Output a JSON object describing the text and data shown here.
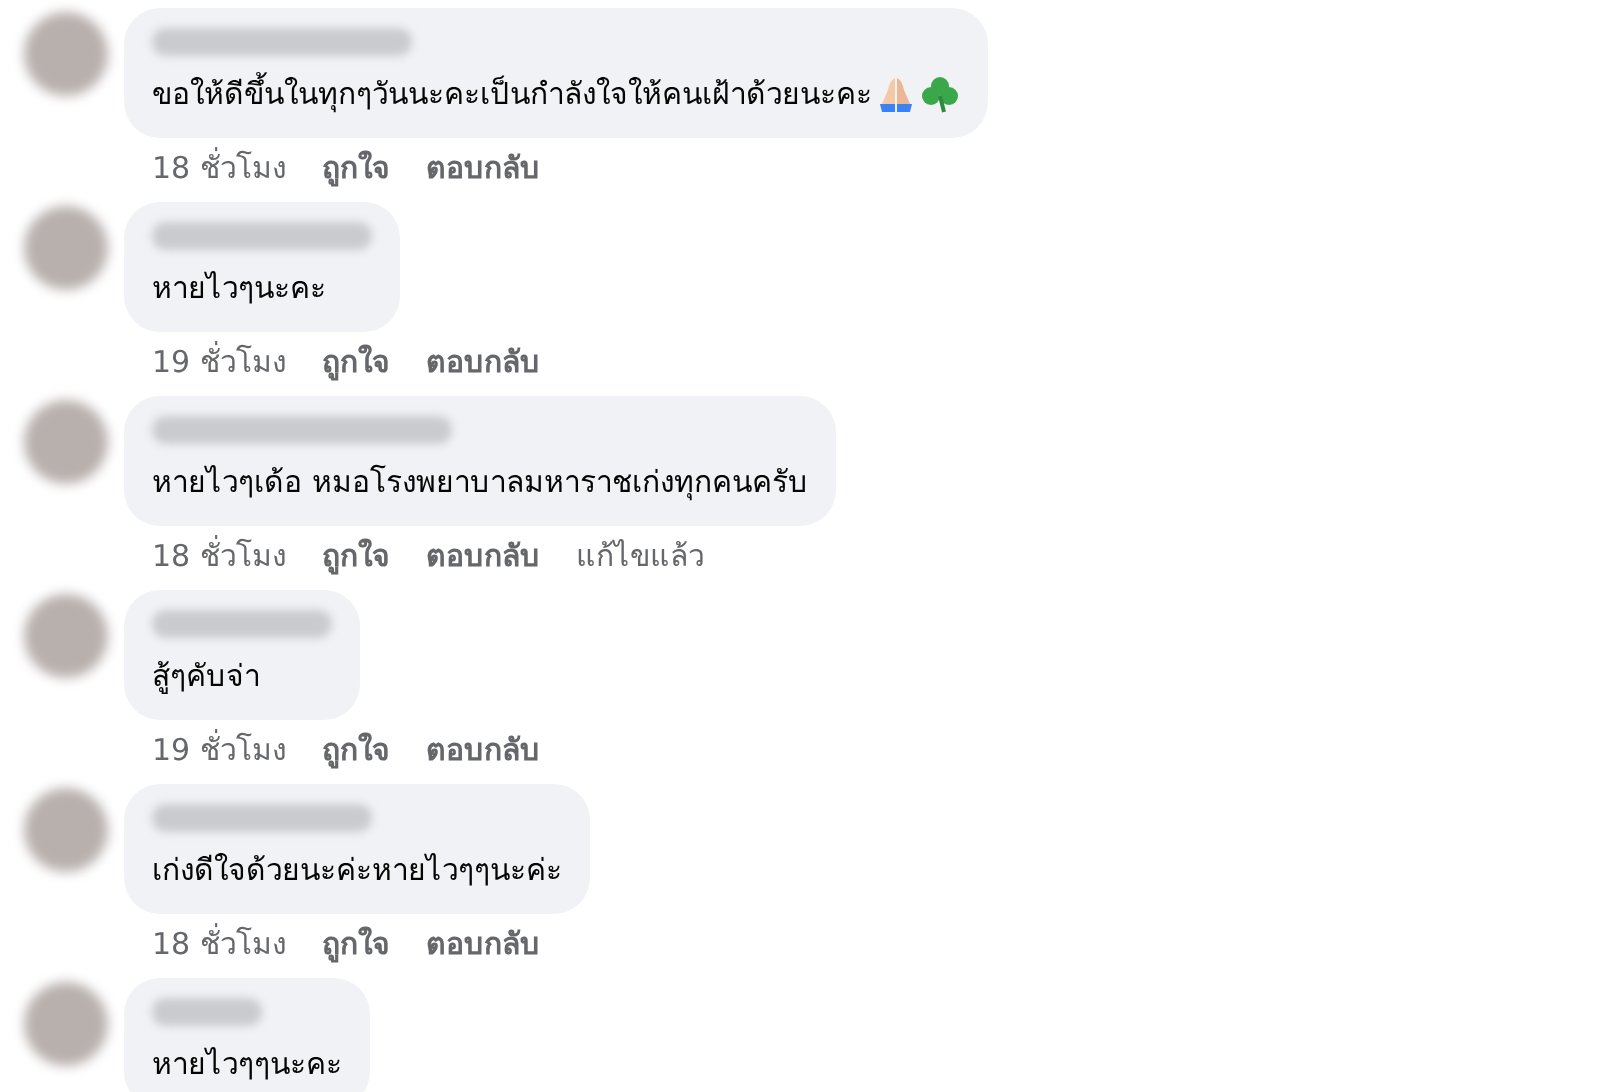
{
  "comments": [
    {
      "text": "ขอให้ดีขึ้นในทุกๆวันนะคะเป็นกำลังใจให้คนเฝ้าด้วยนะคะ",
      "emoji": true,
      "actions": {
        "time": "18 ชั่วโมง",
        "like": "ถูกใจ",
        "reply": "ตอบกลับ"
      }
    },
    {
      "text": "หายไวๆนะคะ",
      "emoji": false,
      "actions": {
        "time": "19 ชั่วโมง",
        "like": "ถูกใจ",
        "reply": "ตอบกลับ"
      }
    },
    {
      "text": "หายไวๆเด้อ หมอโรงพยาบาลมหาราชเก่งทุกคนครับ",
      "emoji": false,
      "actions": {
        "time": "18 ชั่วโมง",
        "like": "ถูกใจ",
        "reply": "ตอบกลับ",
        "edited": "แก้ไขแล้ว"
      }
    },
    {
      "text": "สู้ๆคับจ่า",
      "emoji": false,
      "actions": {
        "time": "19 ชั่วโมง",
        "like": "ถูกใจ",
        "reply": "ตอบกลับ"
      }
    },
    {
      "text": "เก่งดีใจด้วยนะค่ะหายไวๆๆนะค่ะ",
      "emoji": false,
      "actions": {
        "time": "18 ชั่วโมง",
        "like": "ถูกใจ",
        "reply": "ตอบกลับ"
      }
    },
    {
      "text": "หายไวๆๆนะคะ",
      "emoji": false
    }
  ]
}
